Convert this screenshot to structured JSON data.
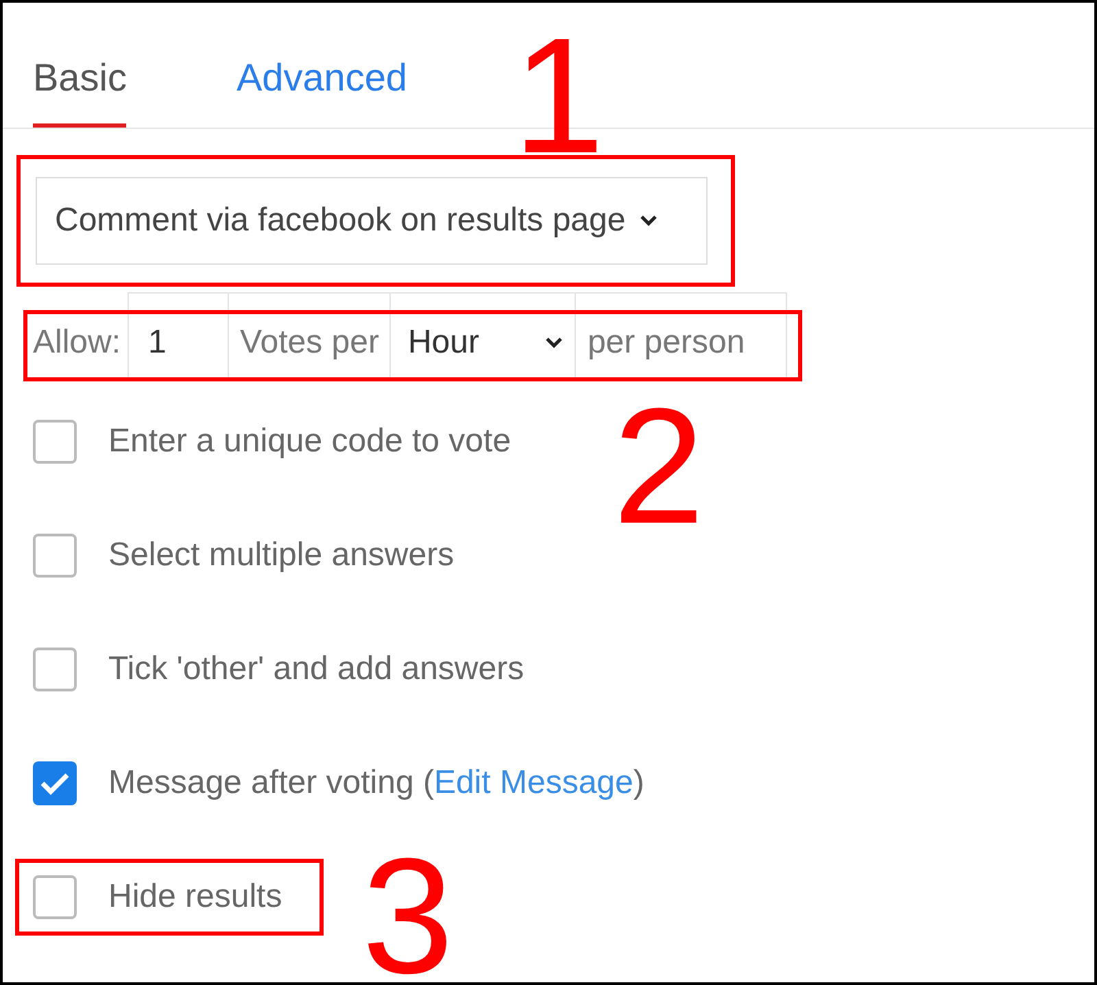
{
  "tabs": [
    {
      "label": "Basic",
      "selected": true
    },
    {
      "label": "Advanced",
      "selected": false
    }
  ],
  "comment_select": {
    "value": "Comment via facebook on results page",
    "boxed": true
  },
  "vote_limit": {
    "boxed": true,
    "prefix": "Allow:",
    "count": "1",
    "middle": "Votes per",
    "period": "Hour",
    "suffix": "per person"
  },
  "options": [
    {
      "label": "Enter a unique code to vote",
      "checked": false,
      "boxed": false
    },
    {
      "label": "Select multiple answers",
      "checked": false,
      "boxed": false
    },
    {
      "label": "Tick 'other' and add answers",
      "checked": false,
      "boxed": false
    },
    {
      "label": "Message after voting (",
      "link": "Edit Message",
      "suffix": ")",
      "checked": true,
      "boxed": false
    },
    {
      "label": "Hide results",
      "checked": false,
      "boxed": true
    }
  ],
  "annotations": [
    "1",
    "2",
    "3"
  ]
}
